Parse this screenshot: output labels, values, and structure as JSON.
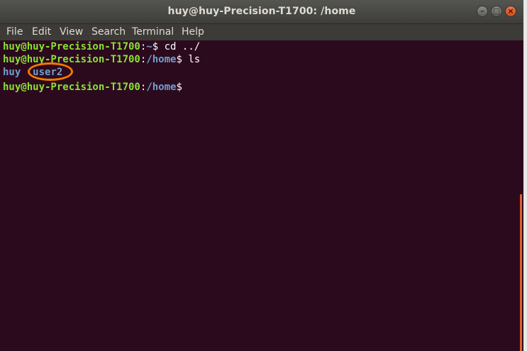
{
  "window": {
    "title": "huy@huy-Precision-T1700: /home"
  },
  "menubar": {
    "items": [
      "File",
      "Edit",
      "View",
      "Search",
      "Terminal",
      "Help"
    ]
  },
  "terminal": {
    "lines": [
      {
        "user": "huy@huy-Precision-T1700",
        "sep": ":",
        "path": "~",
        "suffix": "$ cd ../"
      },
      {
        "user": "huy@huy-Precision-T1700",
        "sep": ":",
        "path": "/home",
        "suffix": "$ ls"
      },
      {
        "dir1": "huy",
        "dir2": "user2"
      },
      {
        "user": "huy@huy-Precision-T1700",
        "sep": ":",
        "path": "/home",
        "suffix": "$ "
      }
    ],
    "colors": {
      "background": "#2c0a1e",
      "prompt_user": "#8ae234",
      "prompt_path": "#729fcf",
      "directory": "#729fcf",
      "annotation": "#f57900"
    }
  },
  "icons": {
    "minimize": "minimize-icon",
    "maximize": "maximize-icon",
    "close": "close-icon"
  },
  "controls": {
    "minimize_glyph": "–",
    "maximize_glyph": "□",
    "close_glyph": "×"
  }
}
